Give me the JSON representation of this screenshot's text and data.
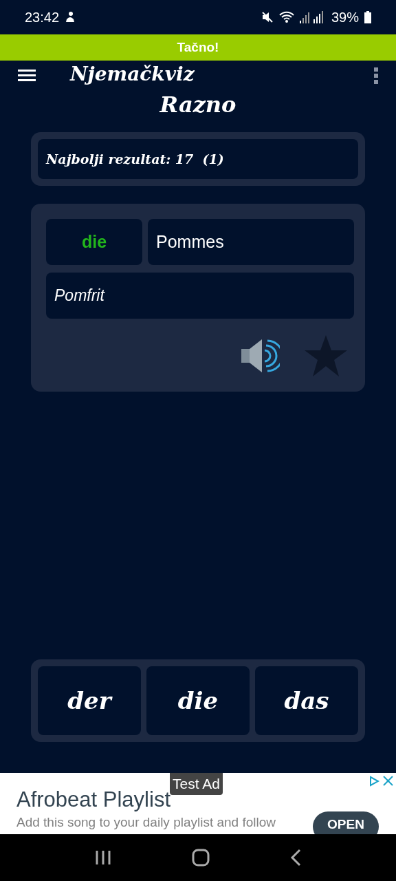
{
  "status_bar": {
    "time": "23:42",
    "battery": "39%"
  },
  "toast": {
    "text": "Tačno!"
  },
  "app_bar": {
    "title": "Njemačkviz"
  },
  "category": "Razno",
  "best_score": {
    "text": "Najbolji rezultat: 17  (1)"
  },
  "word": {
    "article": "die",
    "article_correct": true,
    "noun": "Pommes",
    "translation": "Pomfrit",
    "favorite": false
  },
  "choices": [
    {
      "label": "der"
    },
    {
      "label": "die"
    },
    {
      "label": "das"
    }
  ],
  "ad": {
    "badge": "Test Ad",
    "title": "Afrobeat Playlist",
    "text": "Add this song to your daily playlist and follow",
    "button": "OPEN"
  }
}
